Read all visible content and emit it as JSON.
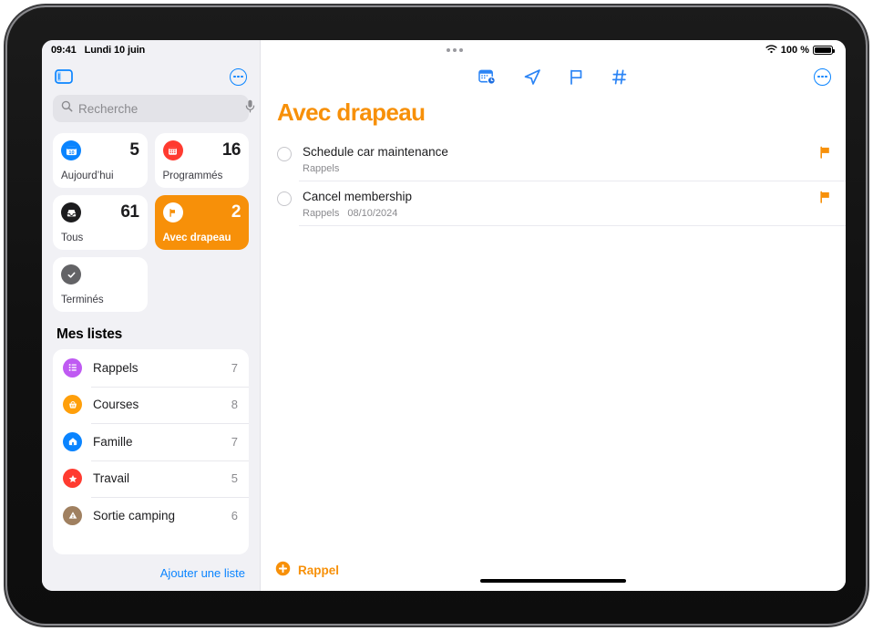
{
  "status_bar": {
    "time": "09:41",
    "date": "Lundi 10 juin",
    "battery_percent": "100 %",
    "wifi_icon": "wifi-icon",
    "multitask_icon": "multitasking-dots-icon"
  },
  "sidebar": {
    "toggle_icon": "sidebar-toggle-icon",
    "more_icon": "more-ellipsis-icon",
    "search": {
      "placeholder": "Recherche",
      "value": "",
      "search_icon": "search-icon",
      "mic_icon": "microphone-icon"
    },
    "smart_lists": [
      {
        "label": "Aujourd’hui",
        "count": "5",
        "icon": "today-calendar-icon",
        "color": "#0a84ff",
        "active": false
      },
      {
        "label": "Programmés",
        "count": "16",
        "icon": "scheduled-calendar-icon",
        "color": "#ff3b30",
        "active": false
      },
      {
        "label": "Tous",
        "count": "61",
        "icon": "all-inbox-icon",
        "color": "#1c1c1e",
        "active": false
      },
      {
        "label": "Avec drapeau",
        "count": "2",
        "icon": "flag-icon",
        "color": "#ffffff",
        "active": true
      },
      {
        "label": "Terminés",
        "count": "",
        "icon": "completed-check-icon",
        "color": "#636366",
        "active": false
      }
    ],
    "lists_header": "Mes listes",
    "lists": [
      {
        "name": "Rappels",
        "count": "7",
        "icon": "bullet-list-icon",
        "color": "#bf5af2"
      },
      {
        "name": "Courses",
        "count": "8",
        "icon": "shopping-basket-icon",
        "color": "#ff9f0a"
      },
      {
        "name": "Famille",
        "count": "7",
        "icon": "house-icon",
        "color": "#0a84ff"
      },
      {
        "name": "Travail",
        "count": "5",
        "icon": "star-icon",
        "color": "#ff3b30"
      },
      {
        "name": "Sortie camping",
        "count": "6",
        "icon": "triangle-exclamation-icon",
        "color": "#a08060"
      }
    ],
    "add_list_label": "Ajouter une liste"
  },
  "main": {
    "toolbar": [
      {
        "icon": "calendar-clock-icon",
        "name": "add-date-button"
      },
      {
        "icon": "location-arrow-icon",
        "name": "add-location-button"
      },
      {
        "icon": "flag-outline-icon",
        "name": "add-flag-button"
      },
      {
        "icon": "hashtag-icon",
        "name": "add-tag-button"
      }
    ],
    "more_icon": "more-ellipsis-icon",
    "title": "Avec drapeau",
    "title_color": "#f79009",
    "reminders": [
      {
        "title": "Schedule car maintenance",
        "list": "Rappels",
        "date": "",
        "flagged": true
      },
      {
        "title": "Cancel membership",
        "list": "Rappels",
        "date": "08/10/2024",
        "flagged": true
      }
    ],
    "add_reminder_label": "Rappel",
    "add_reminder_icon": "plus-circle-icon"
  }
}
